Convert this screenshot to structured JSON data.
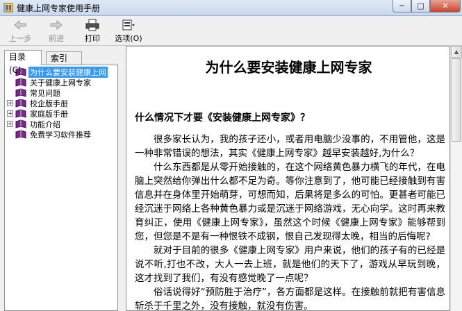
{
  "window": {
    "title": "健康上网专家使用手册",
    "min": "─",
    "max": "□",
    "close": "✕"
  },
  "toolbar": {
    "back": "上一步",
    "forward": "前进",
    "print": "打印",
    "options": "选项(O)"
  },
  "tabs": {
    "contents": "目录(C)",
    "index": "索引(N)"
  },
  "tree": [
    {
      "label": "为什么要安装健康上网",
      "expandable": false,
      "selected": true
    },
    {
      "label": "关于健康上网专家",
      "expandable": false,
      "selected": false
    },
    {
      "label": "常见问题",
      "expandable": false,
      "selected": false
    },
    {
      "label": "校企版手册",
      "expandable": true,
      "selected": false
    },
    {
      "label": "家庭版手册",
      "expandable": true,
      "selected": false
    },
    {
      "label": "功能介绍",
      "expandable": true,
      "selected": false
    },
    {
      "label": "免费学习软件推荐",
      "expandable": false,
      "selected": false
    }
  ],
  "content": {
    "title": "为什么要安装健康上网专家",
    "subtitle": "什么情况下才要《安装健康上网专家》？",
    "paragraphs": [
      "很多家长认为，我的孩子还小，或者用电脑少没事的，不用管他，这是一种非常错误的想法，其实《健康上网专家》越早安装越好,为什么？",
      "什么东西都是从零开始接触的，在这个网络黄色暴力横飞的年代，在电脑上突然给你弹出什么都不足为奇。等你注意到了，他可能已经接触到有害信息并在身体里开始萌芽，可想而知，后果将是多么的可怕。更甚者可能已经沉迷于网络上各种黄色暴力或是沉迷于网络游戏，无心向学。这时再来教育纠正，使用《健康上网专家》，虽然这个时候《健康上网专家》能够帮到您，但您是不是有一种恨铁不成钢，恨自己发现得太晚，相当的后悔呢?",
      "就对于目前的很多《健康上网专家》用户来说，他们的孩子有的已经是说不听,打也不改，大人一去上班，就是他们的天下了，游戏从早玩到晚，这才找到了我们，有没有感觉晚了一点呢？",
      "俗话说得好“预防胜于治疗”，各方面都是这样。在接触前就把有害信息斩杀于千里之外，没有接触，就没有伤害。"
    ]
  },
  "colors": {
    "selection": "#3399ff",
    "book": "#7a2a8c"
  }
}
